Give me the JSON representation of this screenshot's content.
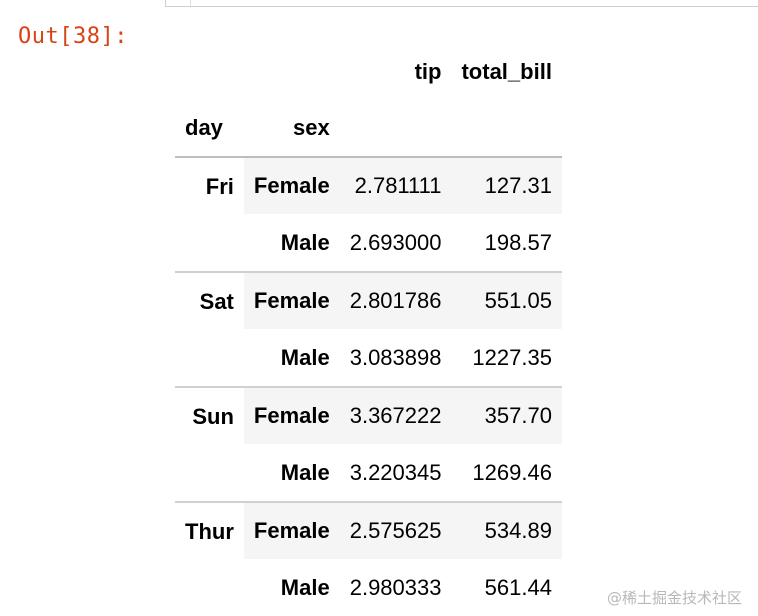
{
  "prompt": "Out[38]:",
  "table": {
    "columns": [
      "tip",
      "total_bill"
    ],
    "index_names": [
      "day",
      "sex"
    ],
    "groups": [
      {
        "day": "Fri",
        "rows": [
          {
            "sex": "Female",
            "tip": "2.781111",
            "total_bill": "127.31"
          },
          {
            "sex": "Male",
            "tip": "2.693000",
            "total_bill": "198.57"
          }
        ]
      },
      {
        "day": "Sat",
        "rows": [
          {
            "sex": "Female",
            "tip": "2.801786",
            "total_bill": "551.05"
          },
          {
            "sex": "Male",
            "tip": "3.083898",
            "total_bill": "1227.35"
          }
        ]
      },
      {
        "day": "Sun",
        "rows": [
          {
            "sex": "Female",
            "tip": "3.367222",
            "total_bill": "357.70"
          },
          {
            "sex": "Male",
            "tip": "3.220345",
            "total_bill": "1269.46"
          }
        ]
      },
      {
        "day": "Thur",
        "rows": [
          {
            "sex": "Female",
            "tip": "2.575625",
            "total_bill": "534.89"
          },
          {
            "sex": "Male",
            "tip": "2.980333",
            "total_bill": "561.44"
          }
        ]
      }
    ]
  },
  "watermark": "@稀土掘金技术社区",
  "colors": {
    "prompt": "#d84315",
    "stripe": "#f5f5f5",
    "border": "#d0d0d0"
  }
}
